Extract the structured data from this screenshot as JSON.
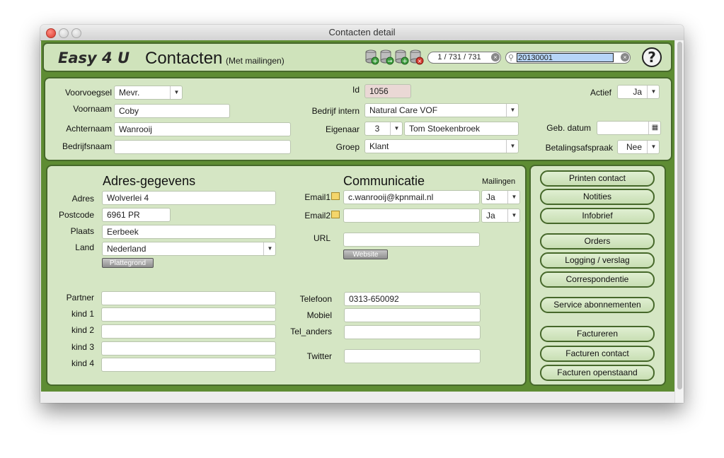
{
  "window": {
    "title": "Contacten detail"
  },
  "header": {
    "brand": "Easy 4 U",
    "title": "Contacten",
    "subtitle": "(Met mailingen)",
    "record_counter": "1 / 731 / 731",
    "search_value": "20130001",
    "toolbar_icons": [
      "database-plus-icon",
      "database-add-icon",
      "database-duplicate-icon",
      "database-delete-icon"
    ],
    "help_label": "?"
  },
  "top": {
    "voorvoegsel": {
      "label": "Voorvoegsel",
      "value": "Mevr."
    },
    "voornaam": {
      "label": "Voornaam",
      "value": "Coby"
    },
    "achternaam": {
      "label": "Achternaam",
      "value": "Wanrooij"
    },
    "bedrijfsnaam": {
      "label": "Bedrijfsnaam",
      "value": ""
    },
    "id": {
      "label": "Id",
      "value": "1056"
    },
    "bedrijf_intern": {
      "label": "Bedrijf intern",
      "value": "Natural Care VOF"
    },
    "eigenaar": {
      "label": "Eigenaar",
      "number": "3",
      "name": "Tom Stoekenbroek"
    },
    "groep": {
      "label": "Groep",
      "value": "Klant"
    },
    "actief": {
      "label": "Actief",
      "value": "Ja"
    },
    "geb_datum": {
      "label": "Geb. datum",
      "value": ""
    },
    "betalingsafspraak": {
      "label": "Betalingsafspraak",
      "value": "Nee"
    }
  },
  "adres": {
    "heading": "Adres-gegevens",
    "adres": {
      "label": "Adres",
      "value": "Wolverlei 4"
    },
    "postcode": {
      "label": "Postcode",
      "value": "6961 PR"
    },
    "plaats": {
      "label": "Plaats",
      "value": "Eerbeek"
    },
    "land": {
      "label": "Land",
      "value": "Nederland"
    },
    "plattegrond_label": "Plattegrond",
    "partner": {
      "label": "Partner",
      "value": ""
    },
    "kind1": {
      "label": "kind 1",
      "value": ""
    },
    "kind2": {
      "label": "kind 2",
      "value": ""
    },
    "kind3": {
      "label": "kind 3",
      "value": ""
    },
    "kind4": {
      "label": "kind 4",
      "value": ""
    }
  },
  "communicatie": {
    "heading": "Communicatie",
    "mailingen_label": "Mailingen",
    "email1": {
      "label": "Email1",
      "value": "c.wanrooij@kpnmail.nl",
      "mailing": "Ja"
    },
    "email2": {
      "label": "Email2",
      "value": "",
      "mailing": "Ja"
    },
    "url": {
      "label": "URL",
      "value": ""
    },
    "website_label": "Website",
    "telefoon": {
      "label": "Telefoon",
      "value": "0313-650092"
    },
    "mobiel": {
      "label": "Mobiel",
      "value": ""
    },
    "tel_anders": {
      "label": "Tel_anders",
      "value": ""
    },
    "twitter": {
      "label": "Twitter",
      "value": ""
    }
  },
  "actions": [
    "Printen contact",
    "Notities",
    "Infobrief",
    "Orders",
    "Logging / verslag",
    "Correspondentie",
    "Service abonnementen",
    "Factureren",
    "Facturen contact",
    "Facturen openstaand"
  ]
}
